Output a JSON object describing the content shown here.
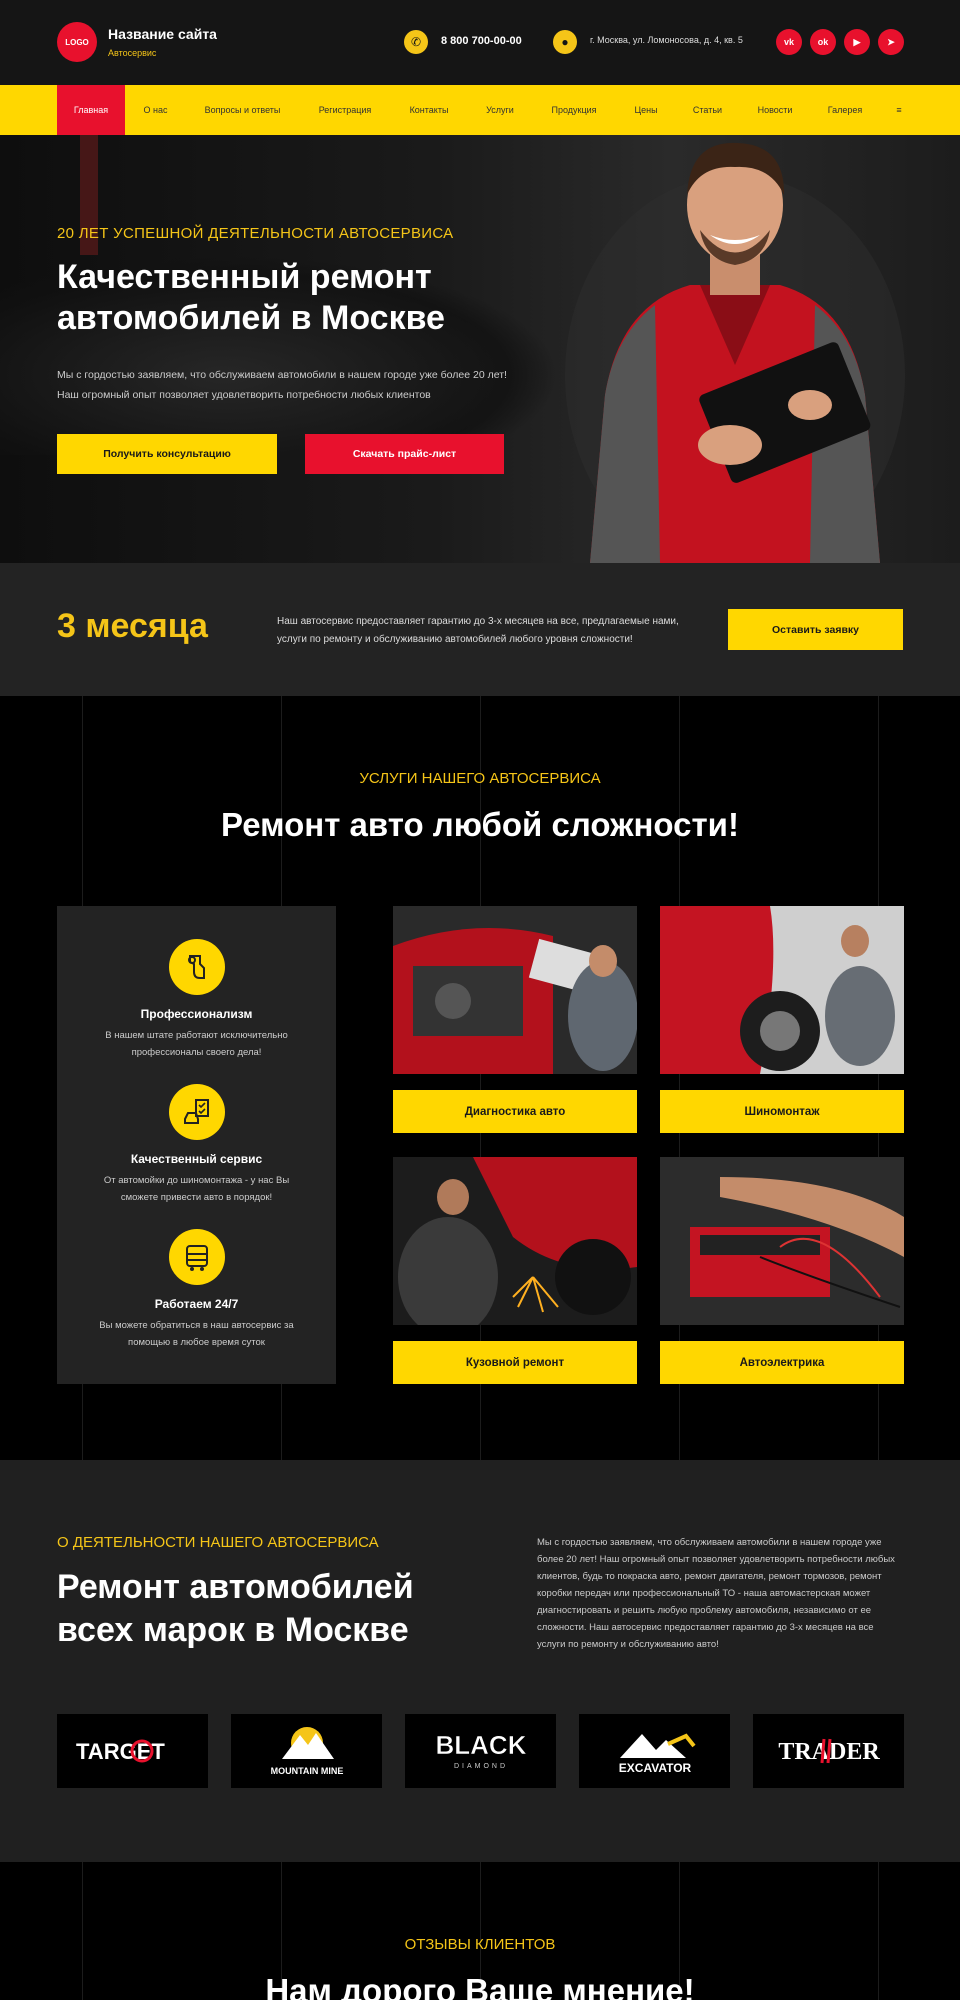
{
  "header": {
    "logo": "LOGO",
    "site_name": "Название сайта",
    "site_sub": "Автосервис",
    "phone": "8 800 700-00-00",
    "address": "г. Москва, ул. Ломоносова, д. 4, кв. 5",
    "social": [
      "vk",
      "ok",
      "youtube",
      "telegram"
    ]
  },
  "nav": {
    "items": [
      "Главная",
      "О нас",
      "Вопросы и ответы",
      "Регистрация",
      "Контакты",
      "Услуги",
      "Продукция",
      "Цены",
      "Статьи",
      "Новости",
      "Галерея",
      "≡"
    ]
  },
  "hero": {
    "kicker": "20 ЛЕТ УСПЕШНОЙ ДЕЯТЕЛЬНОСТИ АВТОСЕРВИСА",
    "title": "Качественный ремонт автомобилей в Москве",
    "text": "Мы с гордостью заявляем, что обслуживаем автомобили в нашем городе уже более 20 лет! Наш огромный опыт позволяет удовлетворить потребности любых клиентов",
    "btn_consult": "Получить консультацию",
    "btn_price": "Скачать прайс-лист"
  },
  "guarantee": {
    "big": "3 месяца",
    "text": "Наш автосервис предоставляет гарантию до 3-х месяцев на все, предлагаемые нами, услуги по ремонту и обслуживанию автомобилей любого уровня сложности!",
    "btn": "Оставить заявку"
  },
  "services": {
    "kicker": "УСЛУГИ НАШЕГО АВТОСЕРВИСА",
    "title": "Ремонт авто любой сложности!",
    "features": [
      {
        "title": "Профессионализм",
        "text": "В нашем штате работают исключительно профессионалы своего дела!"
      },
      {
        "title": "Качественный сервис",
        "text": "От автомойки до шиномонтажа - у нас Вы сможете привести авто в порядок!"
      },
      {
        "title": "Работаем 24/7",
        "text": "Вы можете обратиться в наш автосервис за помощью в любое время суток"
      }
    ],
    "cards": [
      "Диагностика авто",
      "Шиномонтаж",
      "Кузовной ремонт",
      "Автоэлектрика"
    ]
  },
  "about": {
    "kicker": "О ДЕЯТЕЛЬНОСТИ НАШЕГО АВТОСЕРВИСА",
    "title": "Ремонт автомобилей всех марок в Москве",
    "text": "Мы с гордостью заявляем, что обслуживаем автомобили в нашем городе уже более 20 лет! Наш огромный опыт позволяет удовлетворить потребности любых клиентов, будь то покраска авто, ремонт двигателя, ремонт тормозов, ремонт коробки передач или профессиональный ТО - наша автомастерская может диагностировать и решить любую проблему автомобиля, независимо от ее сложности. Наш автосервис предоставляет гарантию до 3-х месяцев на все услуги по ремонту и обслуживанию авто!",
    "brands": [
      "TARGET",
      "MOUNTAIN MINE",
      "BLACK",
      "DIAMOND",
      "EXCAVATOR",
      "TRADER"
    ]
  },
  "reviews": {
    "kicker": "ОТЗЫВЫ КЛИЕНТОВ",
    "title": "Нам дорого Ваше мнение!"
  },
  "colors": {
    "accent": "#ffd700",
    "brand_red": "#e8112d",
    "dark": "#232323"
  }
}
